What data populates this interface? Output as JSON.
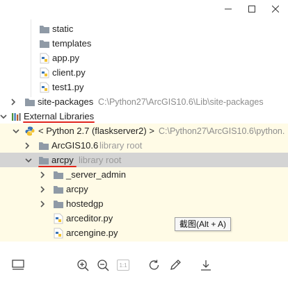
{
  "window": {
    "controls": [
      "minimize",
      "maximize",
      "close"
    ]
  },
  "tree": {
    "rows": [
      {
        "label": "static",
        "icon": "folder-icon"
      },
      {
        "label": "templates",
        "icon": "folder-icon"
      },
      {
        "label": "app.py",
        "icon": "python-file-icon"
      },
      {
        "label": "client.py",
        "icon": "python-file-icon"
      },
      {
        "label": "test1.py",
        "icon": "python-file-icon"
      },
      {
        "label": "site-packages",
        "icon": "folder-icon",
        "hint": "C:\\Python27\\ArcGIS10.6\\Lib\\site-packages",
        "expanded": false
      },
      {
        "label": "External Libraries",
        "icon": "libraries-icon",
        "expanded": true
      },
      {
        "label": "< Python 2.7 (flaskserver2) >",
        "icon": "python-icon",
        "hint": "C:\\Python27\\ArcGIS10.6\\python.",
        "expanded": true
      },
      {
        "label": "ArcGIS10.6",
        "icon": "folder-icon",
        "hint": "library root",
        "expanded": false
      },
      {
        "label": "arcpy",
        "icon": "folder-icon",
        "hint": "library root",
        "expanded": true
      },
      {
        "label": "_server_admin",
        "icon": "folder-icon",
        "expanded": false
      },
      {
        "label": "arcpy",
        "icon": "folder-icon",
        "expanded": false
      },
      {
        "label": "hostedgp",
        "icon": "folder-icon",
        "expanded": false
      },
      {
        "label": "arceditor.py",
        "icon": "python-file-icon"
      },
      {
        "label": "arcengine.py",
        "icon": "python-file-icon"
      }
    ]
  },
  "tooltip": {
    "text": "截图(Alt + A)"
  },
  "toolbar": {
    "buttons": [
      "panel-icon",
      "zoom-in-icon",
      "zoom-out-icon",
      "actual-size-icon",
      "rotate-icon",
      "pen-icon",
      "download-icon"
    ],
    "actual_size_label": "1:1"
  },
  "colors": {
    "accent_red": "#e0241b",
    "library_bg": "#fffbe6",
    "selected_bg": "#d4d4d4",
    "folder": "#8f9aa6",
    "python_blue": "#3a74b5",
    "python_yellow": "#f2c230"
  }
}
